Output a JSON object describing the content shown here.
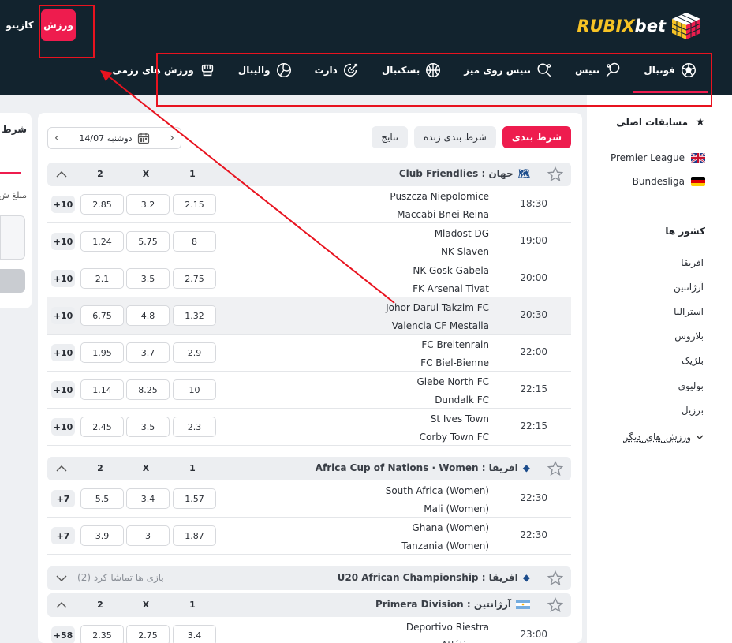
{
  "header": {
    "platform_tabs": [
      {
        "label": "کازینو"
      },
      {
        "label": "ورزش"
      }
    ],
    "logo": {
      "part_a": "RUBIX",
      "part_b": "bet"
    },
    "sports": [
      {
        "label": "فوتبال",
        "icon": "soccer-ball-icon"
      },
      {
        "label": "تنیس",
        "icon": "tennis-racket-icon"
      },
      {
        "label": "تنیس روی میز",
        "icon": "ping-pong-icon"
      },
      {
        "label": "بسکتبال",
        "icon": "basketball-icon"
      },
      {
        "label": "دارت",
        "icon": "dart-icon"
      },
      {
        "label": "والیبال",
        "icon": "volleyball-icon"
      },
      {
        "label": "ورزش های رزمی",
        "icon": "fist-icon"
      }
    ]
  },
  "sidebar": {
    "main_comps_title": "مسابقات اصلی",
    "leagues": [
      {
        "label": "Premier League",
        "flag": "gb"
      },
      {
        "label": "Bundesliga",
        "flag": "de"
      }
    ],
    "countries_title": "کشور ها",
    "countries": [
      "افریقا",
      "آرژانتین",
      "استرالیا",
      "بلاروس",
      "بلژیک",
      "بولیوی",
      "برزیل"
    ],
    "more_label": "ورزش_های_دیگر"
  },
  "left_panel": {
    "title": "شرط ه",
    "sub": "مبلغ ش"
  },
  "main": {
    "tabs": [
      "شرط بندی",
      "شرط بندی زنده",
      "نتایج"
    ],
    "date": "14/07 دوشنبه",
    "col_1": "1",
    "col_x": "X",
    "col_2": "2",
    "groups": [
      {
        "title": "Club Friendlies : جهان",
        "matches": [
          {
            "time": "18:30",
            "home": "Puszcza Niepolomice",
            "away": "Maccabi Bnei Reina",
            "o1": "2.15",
            "ox": "3.2",
            "o2": "2.85",
            "more": "+10"
          },
          {
            "time": "19:00",
            "home": "Mladost DG",
            "away": "NK Slaven",
            "o1": "8",
            "ox": "5.75",
            "o2": "1.24",
            "more": "+10"
          },
          {
            "time": "20:00",
            "home": "NK Gosk Gabela",
            "away": "FK Arsenal Tivat",
            "o1": "2.75",
            "ox": "3.5",
            "o2": "2.1",
            "more": "+10"
          },
          {
            "time": "20:30",
            "home": "Johor Darul Takzim FC",
            "away": "Valencia CF Mestalla",
            "o1": "1.32",
            "ox": "4.8",
            "o2": "6.75",
            "more": "+10"
          },
          {
            "time": "22:00",
            "home": "FC Breitenrain",
            "away": "FC Biel-Bienne",
            "o1": "2.9",
            "ox": "3.7",
            "o2": "1.95",
            "more": "+10"
          },
          {
            "time": "22:15",
            "home": "Glebe North FC",
            "away": "Dundalk FC",
            "o1": "10",
            "ox": "8.25",
            "o2": "1.14",
            "more": "+10"
          },
          {
            "time": "22:15",
            "home": "St Ives Town",
            "away": "Corby Town FC",
            "o1": "2.3",
            "ox": "3.5",
            "o2": "2.45",
            "more": "+10"
          }
        ]
      },
      {
        "title": "Africa Cup of Nations · Women : افریقا",
        "matches": [
          {
            "time": "22:30",
            "home": "South Africa (Women)",
            "away": "Mali (Women)",
            "o1": "1.57",
            "ox": "3.4",
            "o2": "5.5",
            "more": "+7"
          },
          {
            "time": "22:30",
            "home": "Ghana (Women)",
            "away": "Tanzania (Women)",
            "o1": "1.87",
            "ox": "3",
            "o2": "3.9",
            "more": "+7"
          }
        ]
      },
      {
        "title": "U20 African Championship : افریقا",
        "watched": "بازی ها تماشا کرد (2)"
      },
      {
        "title": "Primera Division : آرژانتین",
        "matches": [
          {
            "time": "23:00",
            "home": "Deportivo Riestra",
            "away": "Atlético ...",
            "o1": "3.4",
            "ox": "2.75",
            "o2": "2.35",
            "more": "+58"
          }
        ]
      }
    ]
  },
  "colors": {
    "accent": "#ee1c4e",
    "header_bg": "#12232e",
    "annotation": "#e8131f",
    "logo_yellow": "#f7c325"
  }
}
